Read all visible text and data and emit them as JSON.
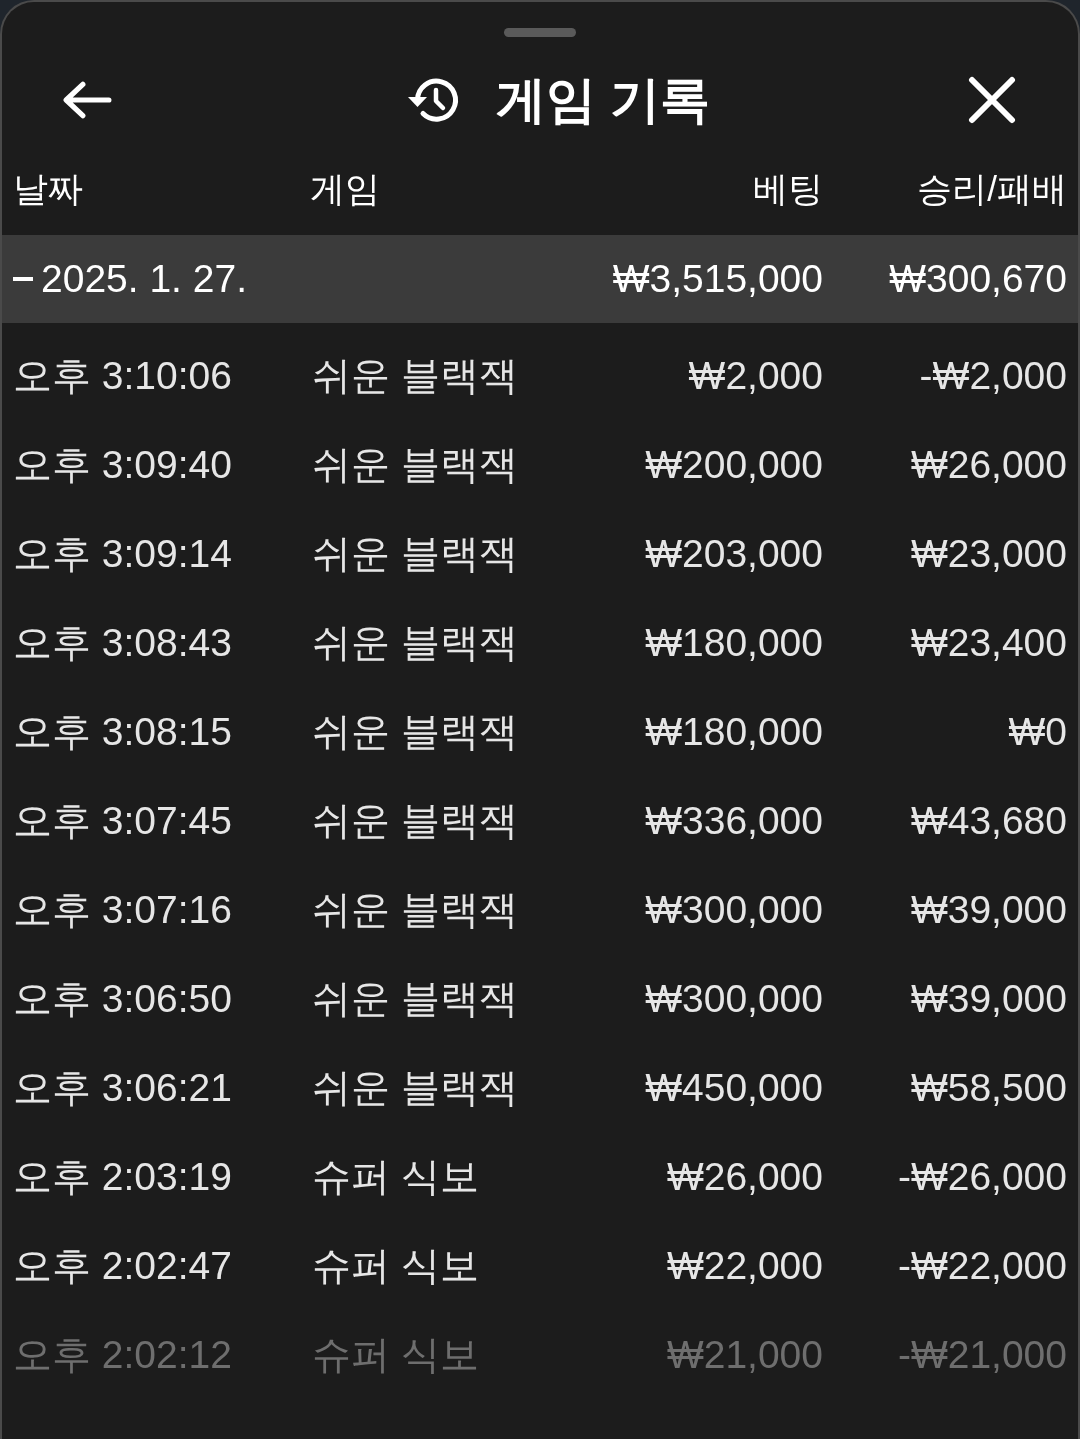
{
  "sheet": {
    "title": "게임 기록"
  },
  "table": {
    "columns": [
      "날짜",
      "게임",
      "베팅",
      "승리/패배"
    ],
    "groups": [
      {
        "date": "2025. 1. 27.",
        "expanded": true,
        "bet_total": "₩3,515,000",
        "result_total": "₩300,670",
        "rows": [
          {
            "time": "오후 3:10:06",
            "game": "쉬운 블랙잭",
            "bet": "₩2,000",
            "result": "-₩2,000"
          },
          {
            "time": "오후 3:09:40",
            "game": "쉬운 블랙잭",
            "bet": "₩200,000",
            "result": "₩26,000"
          },
          {
            "time": "오후 3:09:14",
            "game": "쉬운 블랙잭",
            "bet": "₩203,000",
            "result": "₩23,000"
          },
          {
            "time": "오후 3:08:43",
            "game": "쉬운 블랙잭",
            "bet": "₩180,000",
            "result": "₩23,400"
          },
          {
            "time": "오후 3:08:15",
            "game": "쉬운 블랙잭",
            "bet": "₩180,000",
            "result": "₩0"
          },
          {
            "time": "오후 3:07:45",
            "game": "쉬운 블랙잭",
            "bet": "₩336,000",
            "result": "₩43,680"
          },
          {
            "time": "오후 3:07:16",
            "game": "쉬운 블랙잭",
            "bet": "₩300,000",
            "result": "₩39,000"
          },
          {
            "time": "오후 3:06:50",
            "game": "쉬운 블랙잭",
            "bet": "₩300,000",
            "result": "₩39,000"
          },
          {
            "time": "오후 3:06:21",
            "game": "쉬운 블랙잭",
            "bet": "₩450,000",
            "result": "₩58,500"
          },
          {
            "time": "오후 2:03:19",
            "game": "슈퍼 식보",
            "bet": "₩26,000",
            "result": "-₩26,000"
          },
          {
            "time": "오후 2:02:47",
            "game": "슈퍼 식보",
            "bet": "₩22,000",
            "result": "-₩22,000"
          },
          {
            "time": "오후 2:02:12",
            "game": "슈퍼 식보",
            "bet": "₩21,000",
            "result": "-₩21,000"
          }
        ]
      }
    ]
  }
}
